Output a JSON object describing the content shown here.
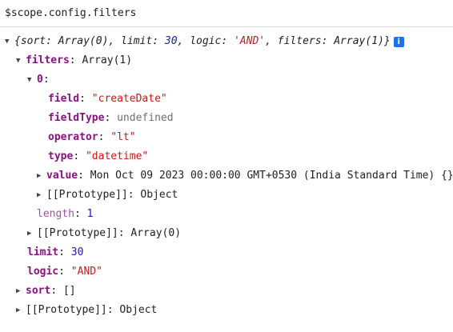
{
  "console": {
    "expression": "$scope.config.filters",
    "summary": {
      "open_brace": "{",
      "sort_key": "sort",
      "sort_value": "Array(0)",
      "limit_key": "limit",
      "limit_value": "30",
      "logic_key": "logic",
      "logic_value": "'AND'",
      "filters_key": "filters",
      "filters_value": "Array(1)",
      "close_brace": "}",
      "info_icon": "i"
    },
    "rows": {
      "filters": {
        "key": "filters",
        "value": "Array(1)"
      },
      "index0": {
        "key": "0"
      },
      "field": {
        "key": "field",
        "value": "\"createDate\""
      },
      "fieldType": {
        "key": "fieldType",
        "value": "undefined"
      },
      "operator": {
        "key": "operator",
        "value": "\"lt\""
      },
      "type": {
        "key": "type",
        "value": "\"datetime\""
      },
      "value": {
        "key": "value",
        "value": "Mon Oct 09 2023 00:00:00 GMT+0530 (India Standard Time) {}"
      },
      "proto_object_inner": {
        "key": "[[Prototype]]",
        "value": "Object"
      },
      "length": {
        "key": "length",
        "value": "1"
      },
      "proto_array": {
        "key": "[[Prototype]]",
        "value": "Array(0)"
      },
      "limit": {
        "key": "limit",
        "value": "30"
      },
      "logic": {
        "key": "logic",
        "value": "\"AND\""
      },
      "sort": {
        "key": "sort",
        "value": "[]"
      },
      "proto_object_outer": {
        "key": "[[Prototype]]",
        "value": "Object"
      }
    }
  }
}
